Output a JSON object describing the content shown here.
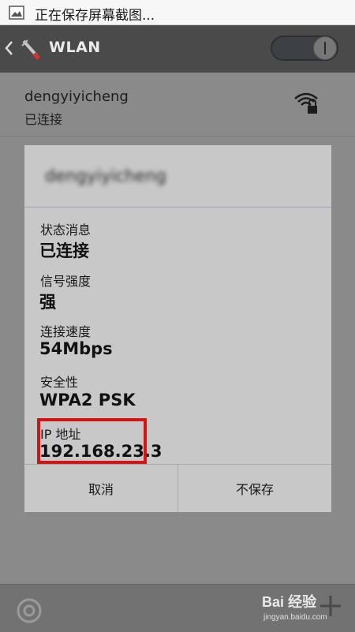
{
  "status_bar": {
    "text": "正在保存屏幕截图..."
  },
  "action_bar": {
    "title": "WLAN",
    "toggle_state": "on"
  },
  "network": {
    "name": "dengyiyicheng",
    "status": "已连接"
  },
  "dialog": {
    "title": "dengyiyicheng",
    "fields": [
      {
        "label": "状态消息",
        "value": "已连接"
      },
      {
        "label": "信号强度",
        "value": "强"
      },
      {
        "label": "连接速度",
        "value": "54Mbps"
      },
      {
        "label": "安全性",
        "value": "WPA2 PSK"
      },
      {
        "label": "IP 地址",
        "value": "192.168.23.3"
      }
    ],
    "cancel_label": "取消",
    "forget_label": "不保存"
  },
  "watermark": {
    "main": "Bai 经验",
    "sub": "jingyan.baidu.com"
  },
  "colors": {
    "highlight": "#d01515",
    "action_bar": "#4a4a4a",
    "dialog_bg": "#c8c8c8"
  }
}
